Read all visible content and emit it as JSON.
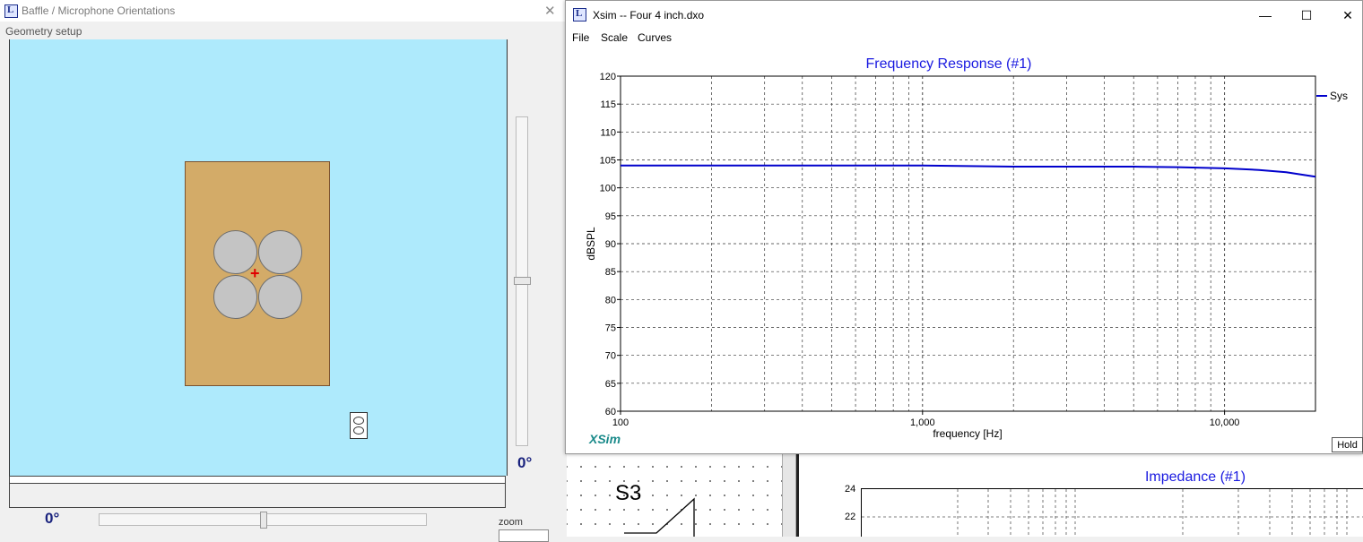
{
  "baffle_window": {
    "title": "Baffle / Microphone Orientations",
    "menu": "Geometry setup",
    "vertical_angle": "0°",
    "horizontal_angle": "0°",
    "zoom_label": "zoom",
    "vertical_slider_value": 0.5,
    "horizontal_slider_value": 0.5
  },
  "xsim_window": {
    "title": "Xsim -- Four 4 inch.dxo",
    "menu": [
      "File",
      "Scale",
      "Curves"
    ],
    "controls": {
      "minimize": "—",
      "maximize": "☐",
      "close": "✕"
    },
    "hold_label": "Hold",
    "brand": "XSim"
  },
  "background": {
    "schematic_label": "S3",
    "impedance_title": "Impedance (#1)",
    "impedance_ticks": [
      "24",
      "22"
    ]
  },
  "colors": {
    "curve": "#0000cc",
    "title": "#1a1ae0",
    "baffle_bg": "#aeeafc",
    "board": "#d3ab68",
    "brand": "#1a8a8a"
  },
  "chart_data": {
    "type": "line",
    "title": "Frequency Response (#1)",
    "xlabel": "frequency [Hz]",
    "ylabel": "dBSPL",
    "x_scale": "log",
    "xlim": [
      100,
      20000
    ],
    "ylim": [
      60,
      120
    ],
    "x_tick_labels": [
      "100",
      "1,000",
      "10,000"
    ],
    "x_tick_values": [
      100,
      1000,
      10000
    ],
    "y_ticks": [
      60,
      65,
      70,
      75,
      80,
      85,
      90,
      95,
      100,
      105,
      110,
      115,
      120
    ],
    "grid": true,
    "legend": "right",
    "series": [
      {
        "name": "Sys",
        "x": [
          100,
          200,
          500,
          1000,
          2000,
          3000,
          5000,
          7000,
          10000,
          13000,
          16000,
          20000
        ],
        "y": [
          104,
          104,
          104,
          104,
          103.8,
          103.8,
          103.8,
          103.7,
          103.5,
          103.2,
          102.8,
          102
        ]
      }
    ]
  }
}
